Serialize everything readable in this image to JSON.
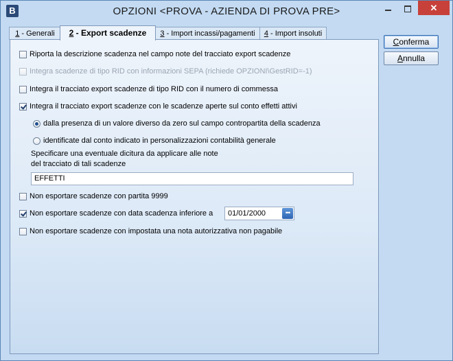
{
  "window": {
    "app_icon_letter": "B",
    "title": "OPZIONI <PROVA - AZIENDA DI PROVA PRE>",
    "close_glyph": "✕"
  },
  "tabs": [
    {
      "hotkey": "1",
      "rest": " - Generali"
    },
    {
      "hotkey": "2",
      "rest": " - Export scadenze"
    },
    {
      "hotkey": "3",
      "rest": " - Import incassi/pagamenti"
    },
    {
      "hotkey": "4",
      "rest": " - Import insoluti"
    }
  ],
  "options": {
    "riporta_descrizione": "Riporta la descrizione scadenza nel campo note del tracciato export scadenze",
    "integra_rid_sepa": "Integra scadenze di tipo RID con informazioni SEPA (richiede OPZIONI\\GestRID=-1)",
    "integra_rid_commessa": "Integra il tracciato export scadenze di tipo RID con il numero di commessa",
    "integra_scadenze_aperte": "Integra il tracciato export scadenze con le scadenze aperte sul conto effetti attivi",
    "radio_valore_diverso": "dalla presenza di un valore diverso da zero sul campo contropartita della scadenza",
    "radio_conto_indicato": "identificate dal conto indicato in personalizzazioni contabilità generale",
    "dicitura_line1": "Specificare una eventuale dicitura da applicare alle note",
    "dicitura_line2": "del tracciato di tali scadenze",
    "dicitura_value": "EFFETTI",
    "non_esportare_9999": "Non esportare scadenze con partita 9999",
    "non_esportare_data": "Non esportare scadenze con data scadenza inferiore a",
    "data_value": "01/01/2000",
    "non_esportare_nota": "Non esportare scadenze con impostata una nota autorizzativa non pagabile"
  },
  "checked": {
    "riporta_descrizione": false,
    "integra_rid_sepa": false,
    "integra_rid_commessa": false,
    "integra_scadenze_aperte": true,
    "radio_valore_diverso": true,
    "radio_conto_indicato": false,
    "non_esportare_9999": false,
    "non_esportare_data": true,
    "non_esportare_nota": false
  },
  "buttons": {
    "conferma": {
      "hotkey": "C",
      "rest": "onferma"
    },
    "annulla": {
      "hotkey": "A",
      "rest": "nnulla"
    }
  },
  "date_button_glyph": "•••"
}
